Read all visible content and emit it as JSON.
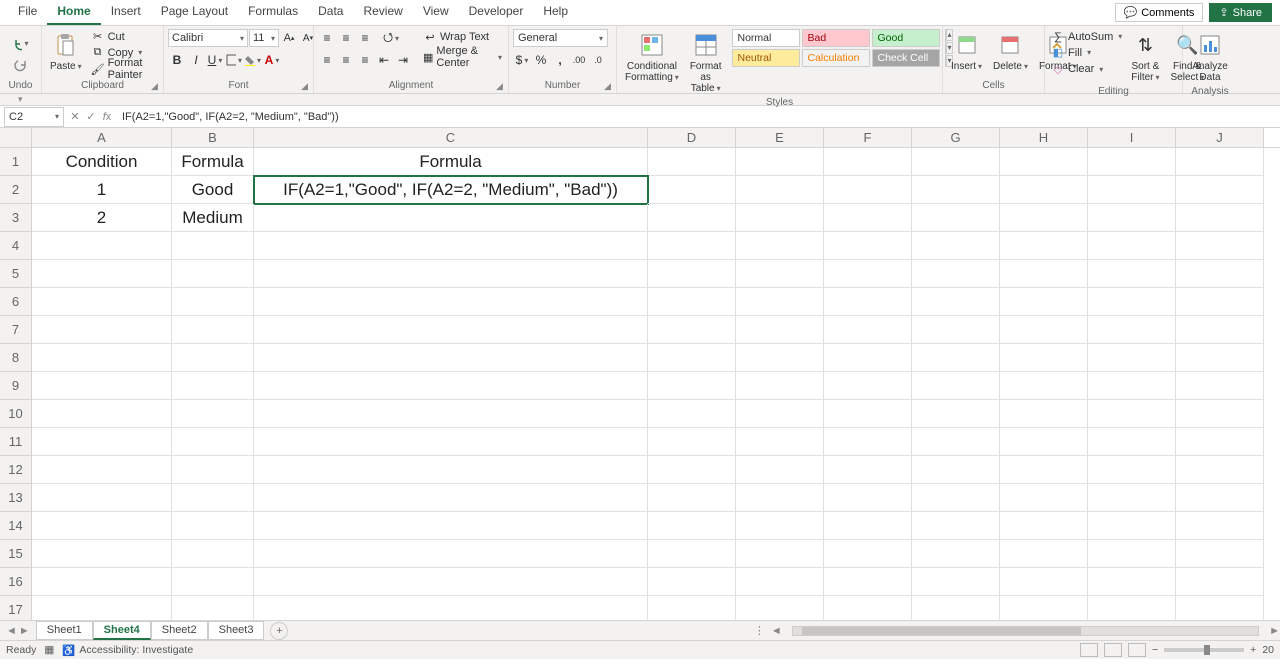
{
  "menu": {
    "tabs": [
      "File",
      "Home",
      "Insert",
      "Page Layout",
      "Formulas",
      "Data",
      "Review",
      "View",
      "Developer",
      "Help"
    ],
    "active": 1,
    "comments": "Comments",
    "share": "Share"
  },
  "ribbon": {
    "undo_label": "Undo",
    "clipboard": {
      "paste": "Paste",
      "cut": "Cut",
      "copy": "Copy",
      "format_painter": "Format Painter",
      "label": "Clipboard"
    },
    "font": {
      "name": "Calibri",
      "size": "11",
      "label": "Font"
    },
    "alignment": {
      "wrap": "Wrap Text",
      "merge": "Merge & Center",
      "label": "Alignment"
    },
    "number": {
      "format": "General",
      "label": "Number"
    },
    "styles": {
      "conditional": "Conditional\nFormatting",
      "table": "Format as\nTable",
      "gallery": [
        {
          "label": "Normal",
          "cls": "style-normal"
        },
        {
          "label": "Bad",
          "cls": "style-bad"
        },
        {
          "label": "Good",
          "cls": "style-good"
        },
        {
          "label": "Neutral",
          "cls": "style-neutral"
        },
        {
          "label": "Calculation",
          "cls": "style-calc"
        },
        {
          "label": "Check Cell",
          "cls": "style-check"
        }
      ],
      "label": "Styles"
    },
    "cells": {
      "insert": "Insert",
      "delete": "Delete",
      "format": "Format",
      "label": "Cells"
    },
    "editing": {
      "autosum": "AutoSum",
      "fill": "Fill",
      "clear": "Clear",
      "sort": "Sort &\nFilter",
      "find": "Find &\nSelect",
      "label": "Editing"
    },
    "analysis": {
      "analyze": "Analyze\nData",
      "label": "Analysis"
    }
  },
  "namebox": "C2",
  "formula": "IF(A2=1,\"Good\", IF(A2=2, \"Medium\", \"Bad\"))",
  "grid": {
    "cols": [
      "A",
      "B",
      "C",
      "D",
      "E",
      "F",
      "G",
      "H",
      "I",
      "J"
    ],
    "rows": 17,
    "data": {
      "A1": "Condition",
      "B1": "Formula",
      "C1": "Formula",
      "A2": "1",
      "B2": "Good",
      "C2": "IF(A2=1,\"Good\", IF(A2=2, \"Medium\", \"Bad\"))",
      "A3": "2",
      "B3": "Medium"
    },
    "selected": "C2"
  },
  "sheets": {
    "tabs": [
      "Sheet1",
      "Sheet4",
      "Sheet2",
      "Sheet3"
    ],
    "active": 1
  },
  "status": {
    "ready": "Ready",
    "access": "Accessibility: Investigate",
    "zoom": "20"
  }
}
